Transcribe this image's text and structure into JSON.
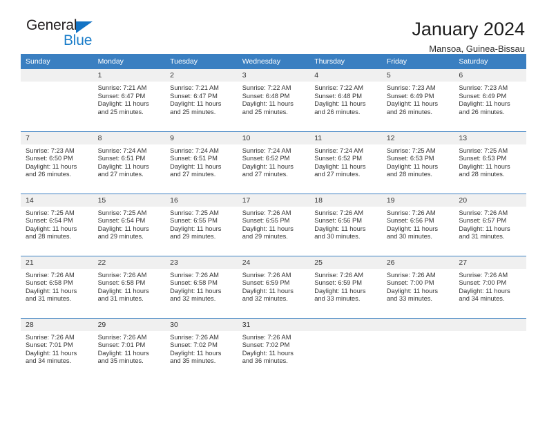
{
  "brand": {
    "name_part1": "General",
    "name_part2": "Blue",
    "accent_color": "#1a7dc9",
    "triangle_icon": "brand-triangle-icon"
  },
  "header": {
    "title": "January 2024",
    "subtitle": "Mansoa, Guinea-Bissau"
  },
  "calendar": {
    "header_bg": "#3a7fc1",
    "daynum_bg": "#f0f0f0",
    "weekday_headers": [
      "Sunday",
      "Monday",
      "Tuesday",
      "Wednesday",
      "Thursday",
      "Friday",
      "Saturday"
    ],
    "weeks": [
      [
        {
          "day": "",
          "lines": []
        },
        {
          "day": "1",
          "lines": [
            "Sunrise: 7:21 AM",
            "Sunset: 6:47 PM",
            "Daylight: 11 hours",
            "and 25 minutes."
          ]
        },
        {
          "day": "2",
          "lines": [
            "Sunrise: 7:21 AM",
            "Sunset: 6:47 PM",
            "Daylight: 11 hours",
            "and 25 minutes."
          ]
        },
        {
          "day": "3",
          "lines": [
            "Sunrise: 7:22 AM",
            "Sunset: 6:48 PM",
            "Daylight: 11 hours",
            "and 25 minutes."
          ]
        },
        {
          "day": "4",
          "lines": [
            "Sunrise: 7:22 AM",
            "Sunset: 6:48 PM",
            "Daylight: 11 hours",
            "and 26 minutes."
          ]
        },
        {
          "day": "5",
          "lines": [
            "Sunrise: 7:23 AM",
            "Sunset: 6:49 PM",
            "Daylight: 11 hours",
            "and 26 minutes."
          ]
        },
        {
          "day": "6",
          "lines": [
            "Sunrise: 7:23 AM",
            "Sunset: 6:49 PM",
            "Daylight: 11 hours",
            "and 26 minutes."
          ]
        }
      ],
      [
        {
          "day": "7",
          "lines": [
            "Sunrise: 7:23 AM",
            "Sunset: 6:50 PM",
            "Daylight: 11 hours",
            "and 26 minutes."
          ]
        },
        {
          "day": "8",
          "lines": [
            "Sunrise: 7:24 AM",
            "Sunset: 6:51 PM",
            "Daylight: 11 hours",
            "and 27 minutes."
          ]
        },
        {
          "day": "9",
          "lines": [
            "Sunrise: 7:24 AM",
            "Sunset: 6:51 PM",
            "Daylight: 11 hours",
            "and 27 minutes."
          ]
        },
        {
          "day": "10",
          "lines": [
            "Sunrise: 7:24 AM",
            "Sunset: 6:52 PM",
            "Daylight: 11 hours",
            "and 27 minutes."
          ]
        },
        {
          "day": "11",
          "lines": [
            "Sunrise: 7:24 AM",
            "Sunset: 6:52 PM",
            "Daylight: 11 hours",
            "and 27 minutes."
          ]
        },
        {
          "day": "12",
          "lines": [
            "Sunrise: 7:25 AM",
            "Sunset: 6:53 PM",
            "Daylight: 11 hours",
            "and 28 minutes."
          ]
        },
        {
          "day": "13",
          "lines": [
            "Sunrise: 7:25 AM",
            "Sunset: 6:53 PM",
            "Daylight: 11 hours",
            "and 28 minutes."
          ]
        }
      ],
      [
        {
          "day": "14",
          "lines": [
            "Sunrise: 7:25 AM",
            "Sunset: 6:54 PM",
            "Daylight: 11 hours",
            "and 28 minutes."
          ]
        },
        {
          "day": "15",
          "lines": [
            "Sunrise: 7:25 AM",
            "Sunset: 6:54 PM",
            "Daylight: 11 hours",
            "and 29 minutes."
          ]
        },
        {
          "day": "16",
          "lines": [
            "Sunrise: 7:25 AM",
            "Sunset: 6:55 PM",
            "Daylight: 11 hours",
            "and 29 minutes."
          ]
        },
        {
          "day": "17",
          "lines": [
            "Sunrise: 7:26 AM",
            "Sunset: 6:55 PM",
            "Daylight: 11 hours",
            "and 29 minutes."
          ]
        },
        {
          "day": "18",
          "lines": [
            "Sunrise: 7:26 AM",
            "Sunset: 6:56 PM",
            "Daylight: 11 hours",
            "and 30 minutes."
          ]
        },
        {
          "day": "19",
          "lines": [
            "Sunrise: 7:26 AM",
            "Sunset: 6:56 PM",
            "Daylight: 11 hours",
            "and 30 minutes."
          ]
        },
        {
          "day": "20",
          "lines": [
            "Sunrise: 7:26 AM",
            "Sunset: 6:57 PM",
            "Daylight: 11 hours",
            "and 31 minutes."
          ]
        }
      ],
      [
        {
          "day": "21",
          "lines": [
            "Sunrise: 7:26 AM",
            "Sunset: 6:58 PM",
            "Daylight: 11 hours",
            "and 31 minutes."
          ]
        },
        {
          "day": "22",
          "lines": [
            "Sunrise: 7:26 AM",
            "Sunset: 6:58 PM",
            "Daylight: 11 hours",
            "and 31 minutes."
          ]
        },
        {
          "day": "23",
          "lines": [
            "Sunrise: 7:26 AM",
            "Sunset: 6:58 PM",
            "Daylight: 11 hours",
            "and 32 minutes."
          ]
        },
        {
          "day": "24",
          "lines": [
            "Sunrise: 7:26 AM",
            "Sunset: 6:59 PM",
            "Daylight: 11 hours",
            "and 32 minutes."
          ]
        },
        {
          "day": "25",
          "lines": [
            "Sunrise: 7:26 AM",
            "Sunset: 6:59 PM",
            "Daylight: 11 hours",
            "and 33 minutes."
          ]
        },
        {
          "day": "26",
          "lines": [
            "Sunrise: 7:26 AM",
            "Sunset: 7:00 PM",
            "Daylight: 11 hours",
            "and 33 minutes."
          ]
        },
        {
          "day": "27",
          "lines": [
            "Sunrise: 7:26 AM",
            "Sunset: 7:00 PM",
            "Daylight: 11 hours",
            "and 34 minutes."
          ]
        }
      ],
      [
        {
          "day": "28",
          "lines": [
            "Sunrise: 7:26 AM",
            "Sunset: 7:01 PM",
            "Daylight: 11 hours",
            "and 34 minutes."
          ]
        },
        {
          "day": "29",
          "lines": [
            "Sunrise: 7:26 AM",
            "Sunset: 7:01 PM",
            "Daylight: 11 hours",
            "and 35 minutes."
          ]
        },
        {
          "day": "30",
          "lines": [
            "Sunrise: 7:26 AM",
            "Sunset: 7:02 PM",
            "Daylight: 11 hours",
            "and 35 minutes."
          ]
        },
        {
          "day": "31",
          "lines": [
            "Sunrise: 7:26 AM",
            "Sunset: 7:02 PM",
            "Daylight: 11 hours",
            "and 36 minutes."
          ]
        },
        {
          "day": "",
          "lines": []
        },
        {
          "day": "",
          "lines": []
        },
        {
          "day": "",
          "lines": []
        }
      ]
    ]
  }
}
